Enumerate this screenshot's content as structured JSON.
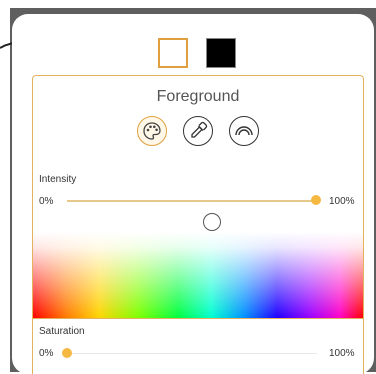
{
  "picker": {
    "title": "Foreground",
    "modes": [
      {
        "icon": "palette-icon",
        "active": true
      },
      {
        "icon": "eyedropper-icon",
        "active": false
      },
      {
        "icon": "spectrum-arc-icon",
        "active": false
      }
    ]
  },
  "swatches": {
    "foreground_color": "#ffffff",
    "background_color": "#000000"
  },
  "intensity": {
    "label": "Intensity",
    "min_label": "0%",
    "max_label": "100%",
    "value_percent": 100
  },
  "saturation": {
    "label": "Saturation",
    "min_label": "0%",
    "max_label": "100%",
    "value_percent": 0
  },
  "colors": {
    "accent": "#f5b942",
    "border": "#e4b25c"
  }
}
